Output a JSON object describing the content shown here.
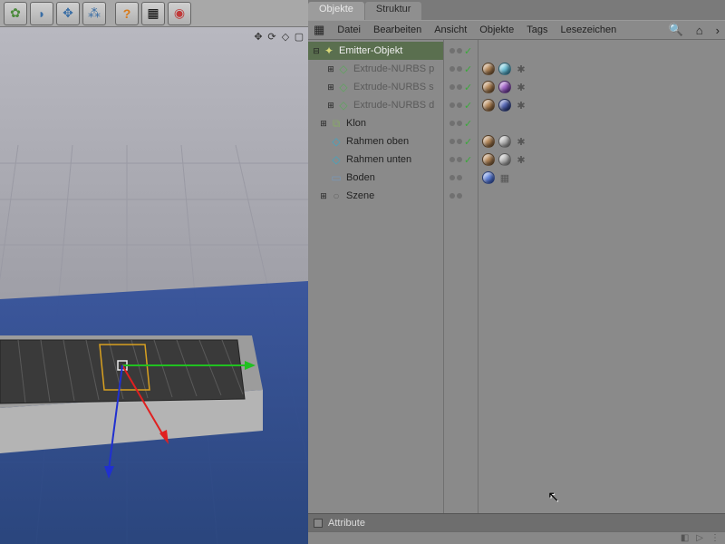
{
  "tabs": {
    "objekte": "Objekte",
    "struktur": "Struktur"
  },
  "menu": {
    "datei": "Datei",
    "bearbeiten": "Bearbeiten",
    "ansicht": "Ansicht",
    "objekte": "Objekte",
    "tags": "Tags",
    "lesezeichen": "Lesezeichen"
  },
  "tree": {
    "emitter": "Emitter-Objekt",
    "extrude_p": "Extrude-NURBS p",
    "extrude_s": "Extrude-NURBS s",
    "extrude_d": "Extrude-NURBS d",
    "klon": "Klon",
    "rahmen_oben": "Rahmen oben",
    "rahmen_unten": "Rahmen unten",
    "boden": "Boden",
    "szene": "Szene"
  },
  "attribute": {
    "label": "Attribute"
  },
  "toolbar_icons": {
    "flower": "flower",
    "primitive": "primitive",
    "arrows": "arrows",
    "particles": "particles",
    "help": "help",
    "grid": "grid",
    "globe": "globe"
  }
}
